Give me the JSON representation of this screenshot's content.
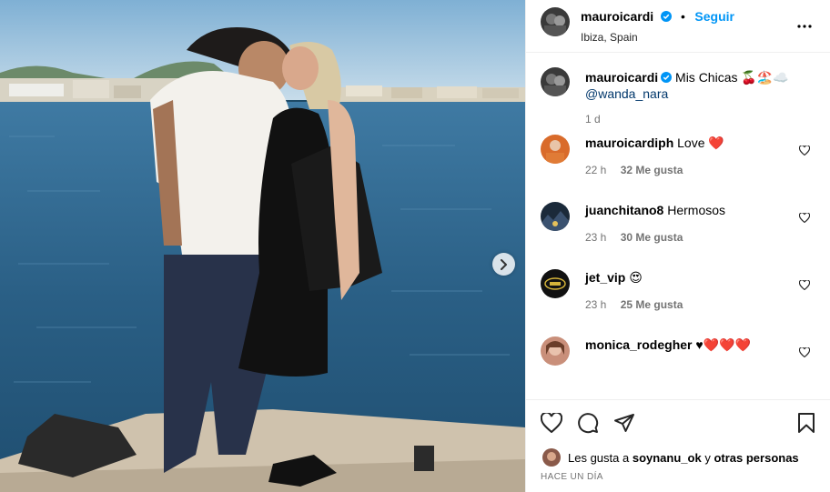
{
  "post": {
    "username": "mauroicardi",
    "follow_label": "Seguir",
    "separator": "•",
    "location": "Ibiza, Spain"
  },
  "caption": {
    "username": "mauroicardi",
    "text": "Mis Chicas 🍒🏖️☁️",
    "mention": "@wanda_nara",
    "time": "1 d"
  },
  "comments": [
    {
      "username": "mauroicardiph",
      "text": "Love ❤️",
      "time": "22 h",
      "likes": "32 Me gusta",
      "avatar_color": "#d96b2b"
    },
    {
      "username": "juanchitano8",
      "text": "Hermosos",
      "time": "23 h",
      "likes": "30 Me gusta",
      "avatar_color": "#1b2a3a"
    },
    {
      "username": "jet_vip",
      "text": "😍",
      "time": "23 h",
      "likes": "25 Me gusta",
      "avatar_color": "#111111"
    },
    {
      "username": "monica_rodegher",
      "text": "♥❤️❤️❤️",
      "time": "",
      "likes": "",
      "avatar_color": "#c98f7a"
    }
  ],
  "likes_bar": {
    "prefix": "Les gusta a",
    "user": "soynanu_ok",
    "conj": "y",
    "others": "otras personas"
  },
  "posted_ago": "HACE UN DÍA",
  "colors": {
    "accent": "#0095f6",
    "verified": "#0095f6",
    "muted": "#737373"
  },
  "icons": [
    "verified-badge-icon",
    "more-options-icon",
    "heart-icon",
    "comment-icon",
    "share-icon",
    "bookmark-icon",
    "chevron-right-icon"
  ]
}
